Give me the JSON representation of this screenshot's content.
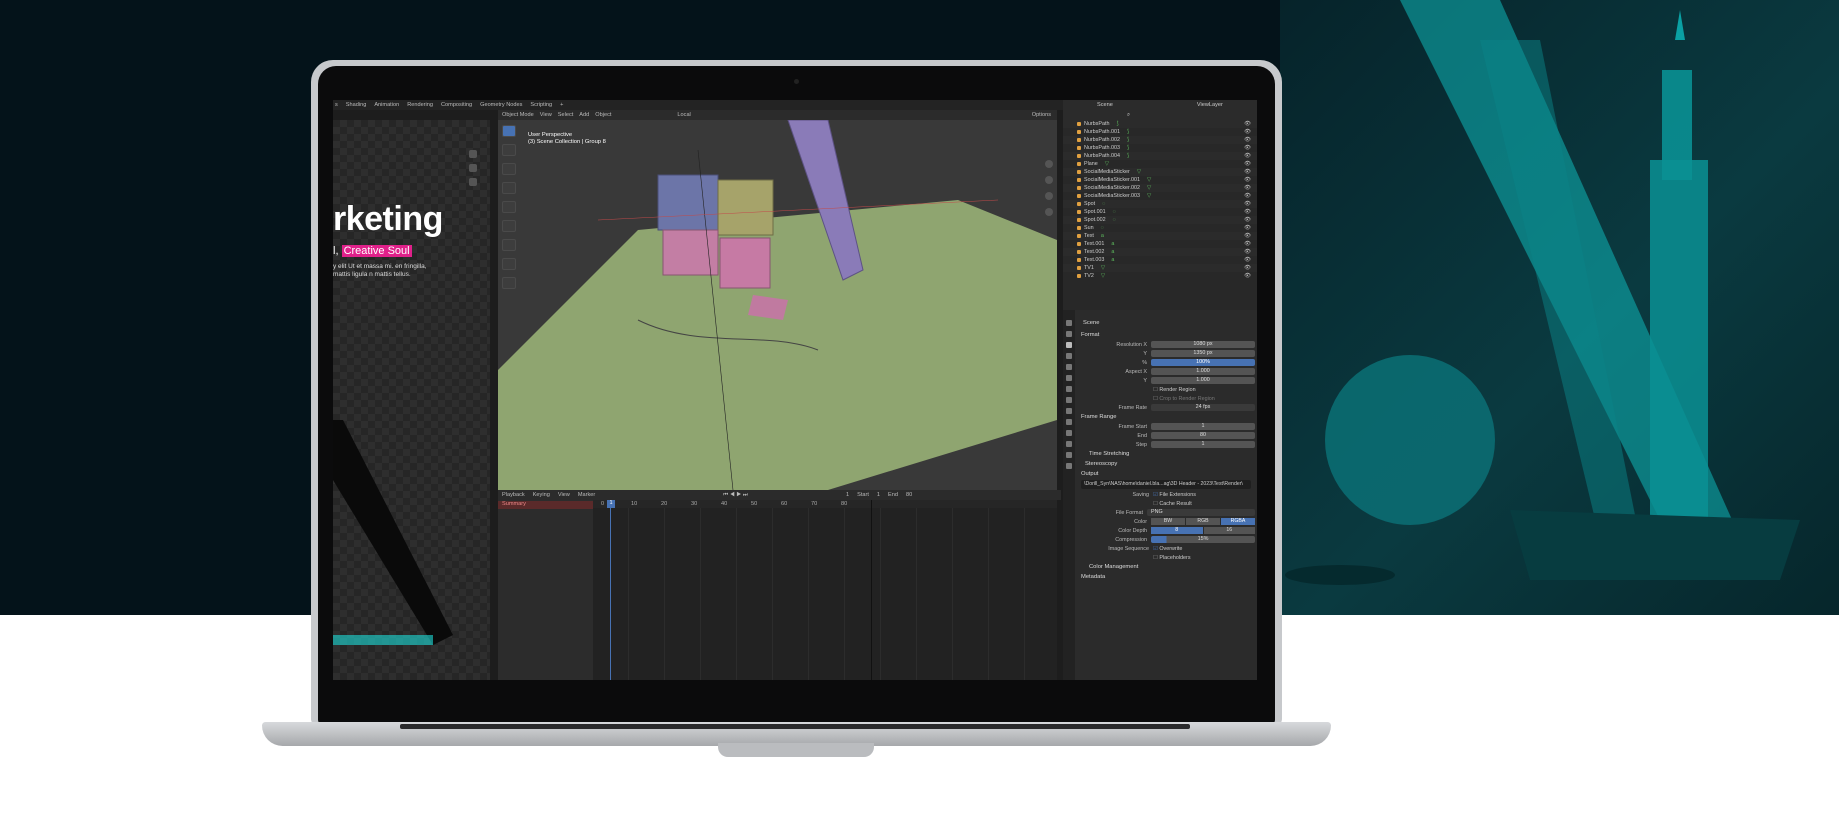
{
  "topbar": {
    "tabs": [
      "s",
      "Shading",
      "Animation",
      "Rendering",
      "Compositing",
      "Geometry Nodes",
      "Scripting",
      "+"
    ]
  },
  "ref_view": {
    "title": "rketing",
    "sub_prefix": "l, ",
    "sub_highlight": "Creative Soul",
    "body": "y elit Ut et massa mi. en fringilla, mattis ligula n mattis tellus."
  },
  "viewport": {
    "header": [
      "Object Mode",
      "View",
      "Select",
      "Add",
      "Object"
    ],
    "orientation": "Local",
    "options": "Options",
    "info_line1": "User Perspective",
    "info_line2": "(3) Scene Collection | Group 8"
  },
  "timeline": {
    "header": [
      "Playback",
      "Keying",
      "View",
      "Marker"
    ],
    "current_frame": "1",
    "start_label": "Start",
    "start_value": "1",
    "end_label": "End",
    "end_value": "80",
    "summary": "Summary",
    "ruler": [
      "0",
      "10",
      "20",
      "30",
      "40",
      "50",
      "60",
      "70",
      "80"
    ]
  },
  "outliner": {
    "scene": "Scene",
    "view_layer": "ViewLayer",
    "items": [
      "NurbsPath",
      "NurbsPath.001",
      "NurbsPath.002",
      "NurbsPath.003",
      "NurbsPath.004",
      "Plane",
      "SocialMediaSticker",
      "SocialMediaSticker.001",
      "SocialMediaSticker.002",
      "SocialMediaSticker.003",
      "Spot",
      "Spot.001",
      "Spot.002",
      "Sun",
      "Text",
      "Text.001",
      "Text.002",
      "Text.003",
      "TV1",
      "TV2"
    ]
  },
  "properties": {
    "scene": "Scene",
    "format_label": "Format",
    "res_x_label": "Resolution X",
    "res_x": "1080 px",
    "res_y_label": "Y",
    "res_y": "1350 px",
    "res_pct_label": "%",
    "res_pct": "100%",
    "aspect_x_label": "Aspect X",
    "aspect_x": "1.000",
    "aspect_y_label": "Y",
    "aspect_y": "1.000",
    "render_region": "Render Region",
    "crop_region": "Crop to Render Region",
    "frame_rate_label": "Frame Rate",
    "frame_rate": "24 fps",
    "frame_range_label": "Frame Range",
    "frame_start_label": "Frame Start",
    "frame_start": "1",
    "end_label": "End",
    "end": "80",
    "step_label": "Step",
    "step": "1",
    "time_stretching": "Time Stretching",
    "stereoscopy": "Stereoscopy",
    "output_label": "Output",
    "output_path": "\\Dorill_Syn\\NAS\\home\\daniel.bla...ag\\3D Header - 2023\\Test\\Render\\",
    "saving_label": "Saving",
    "file_extensions": "File Extensions",
    "cache_result": "Cache Result",
    "file_format_label": "File Format",
    "file_format": "PNG",
    "color_label": "Color",
    "color_opts": [
      "BW",
      "RGB",
      "RGBA"
    ],
    "depth_label": "Color Depth",
    "depth_opts": [
      "8",
      "16"
    ],
    "compression_label": "Compression",
    "compression": "15%",
    "image_seq_label": "Image Sequence",
    "overwrite": "Overwrite",
    "placeholders": "Placeholders",
    "color_management": "Color Management",
    "metadata": "Metadata"
  }
}
